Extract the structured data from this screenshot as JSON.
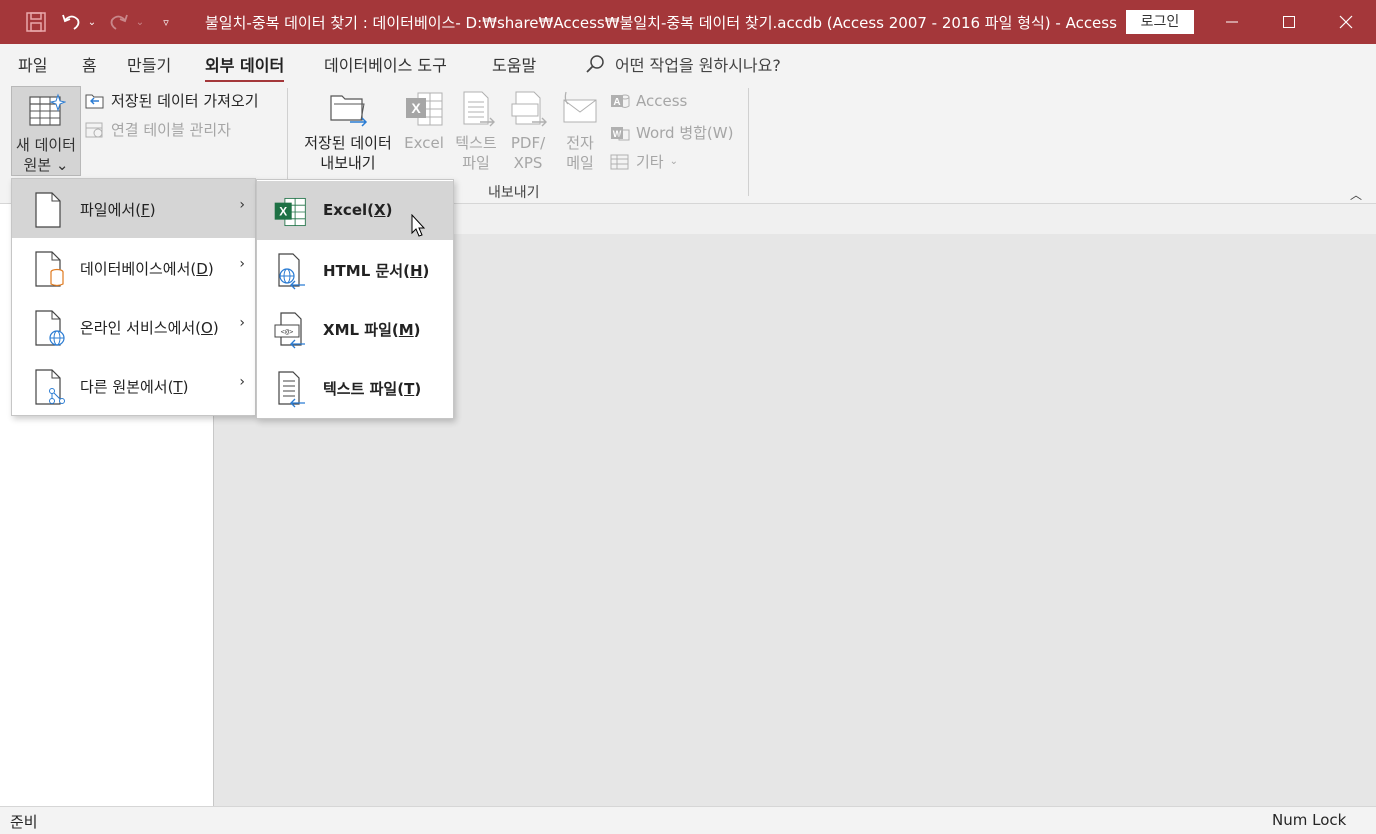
{
  "titlebar": {
    "title": "불일치-중복 데이터 찾기 : 데이터베이스- D:₩share₩Access₩불일치-중복 데이터 찾기.accdb (Access 2007 - 2016 파일 형식)  -  Access",
    "login": "로그인"
  },
  "tabs": [
    "파일",
    "홈",
    "만들기",
    "외부 데이터",
    "데이터베이스 도구",
    "도움말"
  ],
  "tell_me": "어떤 작업을 원하시나요?",
  "ribbon": {
    "new_source": "새 데이터\n원본",
    "saved_imports": "저장된 데이터 가져오기",
    "linked_table_manager": "연결 테이블 관리자",
    "saved_exports_1": "저장된 데이터",
    "saved_exports_2": "내보내기",
    "excel": "Excel",
    "text_1": "텍스트",
    "text_2": "파일",
    "pdf_1": "PDF/",
    "pdf_2": "XPS",
    "email_1": "전자",
    "email_2": "메일",
    "access": "Access",
    "word_merge": "Word 병합(W)",
    "more": "기타",
    "export_group": "내보내기"
  },
  "menu_sources": [
    {
      "label": "파일에서(",
      "key": "F",
      "tail": ")"
    },
    {
      "label": "데이터베이스에서(",
      "key": "D",
      "tail": ")"
    },
    {
      "label": "온라인 서비스에서(",
      "key": "O",
      "tail": ")"
    },
    {
      "label": "다른 원본에서(",
      "key": "T",
      "tail": ")"
    }
  ],
  "menu_file": [
    {
      "label": "Excel(",
      "key": "X",
      "tail": ")"
    },
    {
      "label": "HTML 문서(",
      "key": "H",
      "tail": ")"
    },
    {
      "label": "XML 파일(",
      "key": "M",
      "tail": ")"
    },
    {
      "label": "텍스트 파일(",
      "key": "T",
      "tail": ")"
    }
  ],
  "status": {
    "left": "준비",
    "right": "Num Lock"
  },
  "colors": {
    "accent": "#a4373a",
    "excel_green": "#1e7145"
  }
}
